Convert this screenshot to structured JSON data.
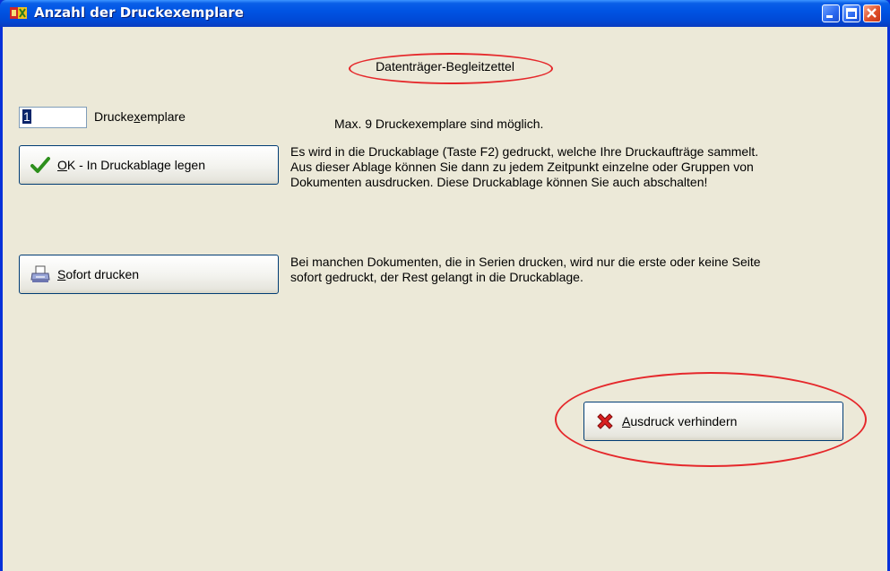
{
  "window": {
    "title": "Anzahl der Druckexemplare",
    "title_bar_color": "#0054e3",
    "client_bg": "#ece9d8"
  },
  "document_label": "Datenträger-Begleitzettel",
  "copies": {
    "value": "1",
    "label_pre": "Drucke",
    "label_mnemonic": "x",
    "label_post": "emplare",
    "hint": "Max. 9 Druckexemplare sind möglich."
  },
  "ok_button": {
    "mnemonic": "O",
    "label_rest": "K - In Druckablage legen",
    "icon": "checkmark-icon",
    "description": [
      "Es wird in die Druckablage (Taste F2) gedruckt, welche Ihre Druckaufträge sammelt.",
      "Aus dieser Ablage können Sie dann zu jedem Zeitpunkt einzelne oder Gruppen von",
      "Dokumenten ausdrucken. Diese Druckablage können Sie auch abschalten!"
    ]
  },
  "print_now_button": {
    "mnemonic": "S",
    "label_rest": "ofort drucken",
    "icon": "printer-icon",
    "description": [
      "Bei manchen Dokumenten, die in Serien drucken, wird nur die erste oder keine Seite",
      "sofort gedruckt, der Rest gelangt in die Druckablage."
    ]
  },
  "cancel_button": {
    "mnemonic": "A",
    "label_rest": "usdruck verhindern",
    "icon": "cancel-cross-icon"
  },
  "highlight_color": "#e5282b"
}
